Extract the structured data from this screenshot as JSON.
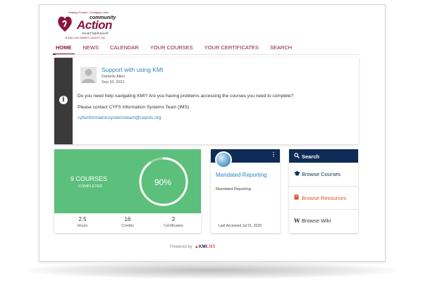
{
  "logo": {
    "tagline": "Helping People. Changing Lives.",
    "line1": "community",
    "line2": "Action",
    "line3": "PARTNERSHIP",
    "line4": "of SAN LUIS OBISPO COUNTY, INC."
  },
  "nav": {
    "tabs": [
      {
        "label": "HOME"
      },
      {
        "label": "NEWS"
      },
      {
        "label": "CALENDAR"
      },
      {
        "label": "YOUR COURSES"
      },
      {
        "label": "YOUR CERTIFICATES"
      },
      {
        "label": "SEARCH"
      }
    ]
  },
  "announcement": {
    "title": "Support with using KMI",
    "author": "Danielle Allen",
    "date": "Sep 10, 2021",
    "paragraph1": "Do you need help navigating KMI? Are you having problems accessing the courses you need to complete?",
    "paragraph2": "Please contact CYFS Information Systems Team (IMS)",
    "email": "cyfsinformationsystemsteam@capslo.org",
    "icon": "info-icon"
  },
  "progress": {
    "courses": "9 COURSES",
    "completed_label": "COMPLETED",
    "percent": "90%",
    "percent_value": 0.9,
    "stats": [
      {
        "value": "2.5",
        "label": "Hours"
      },
      {
        "value": "16",
        "label": "Credits"
      },
      {
        "value": "2",
        "label": "Certificates"
      }
    ]
  },
  "course": {
    "title": "Mandated Reporting",
    "subtitle": "Mandated Reporting",
    "last_accessed": "Last Accessed Jul 31, 2020",
    "menu_icon": "kebab-menu-icon"
  },
  "actions": {
    "search_label": "Search",
    "browse_courses": "Browse Courses",
    "browse_resources": "Browse Resources",
    "browse_wiki": "Browse Wiki"
  },
  "footer": {
    "powered_by": "Powered by",
    "brand_kmi": "KMI",
    "brand_lms": "LMS"
  },
  "colors": {
    "brand": "#8a1538",
    "navy": "#0d2b55",
    "green": "#5cbf7b",
    "link": "#2a86c0",
    "orange": "#d9542a"
  }
}
